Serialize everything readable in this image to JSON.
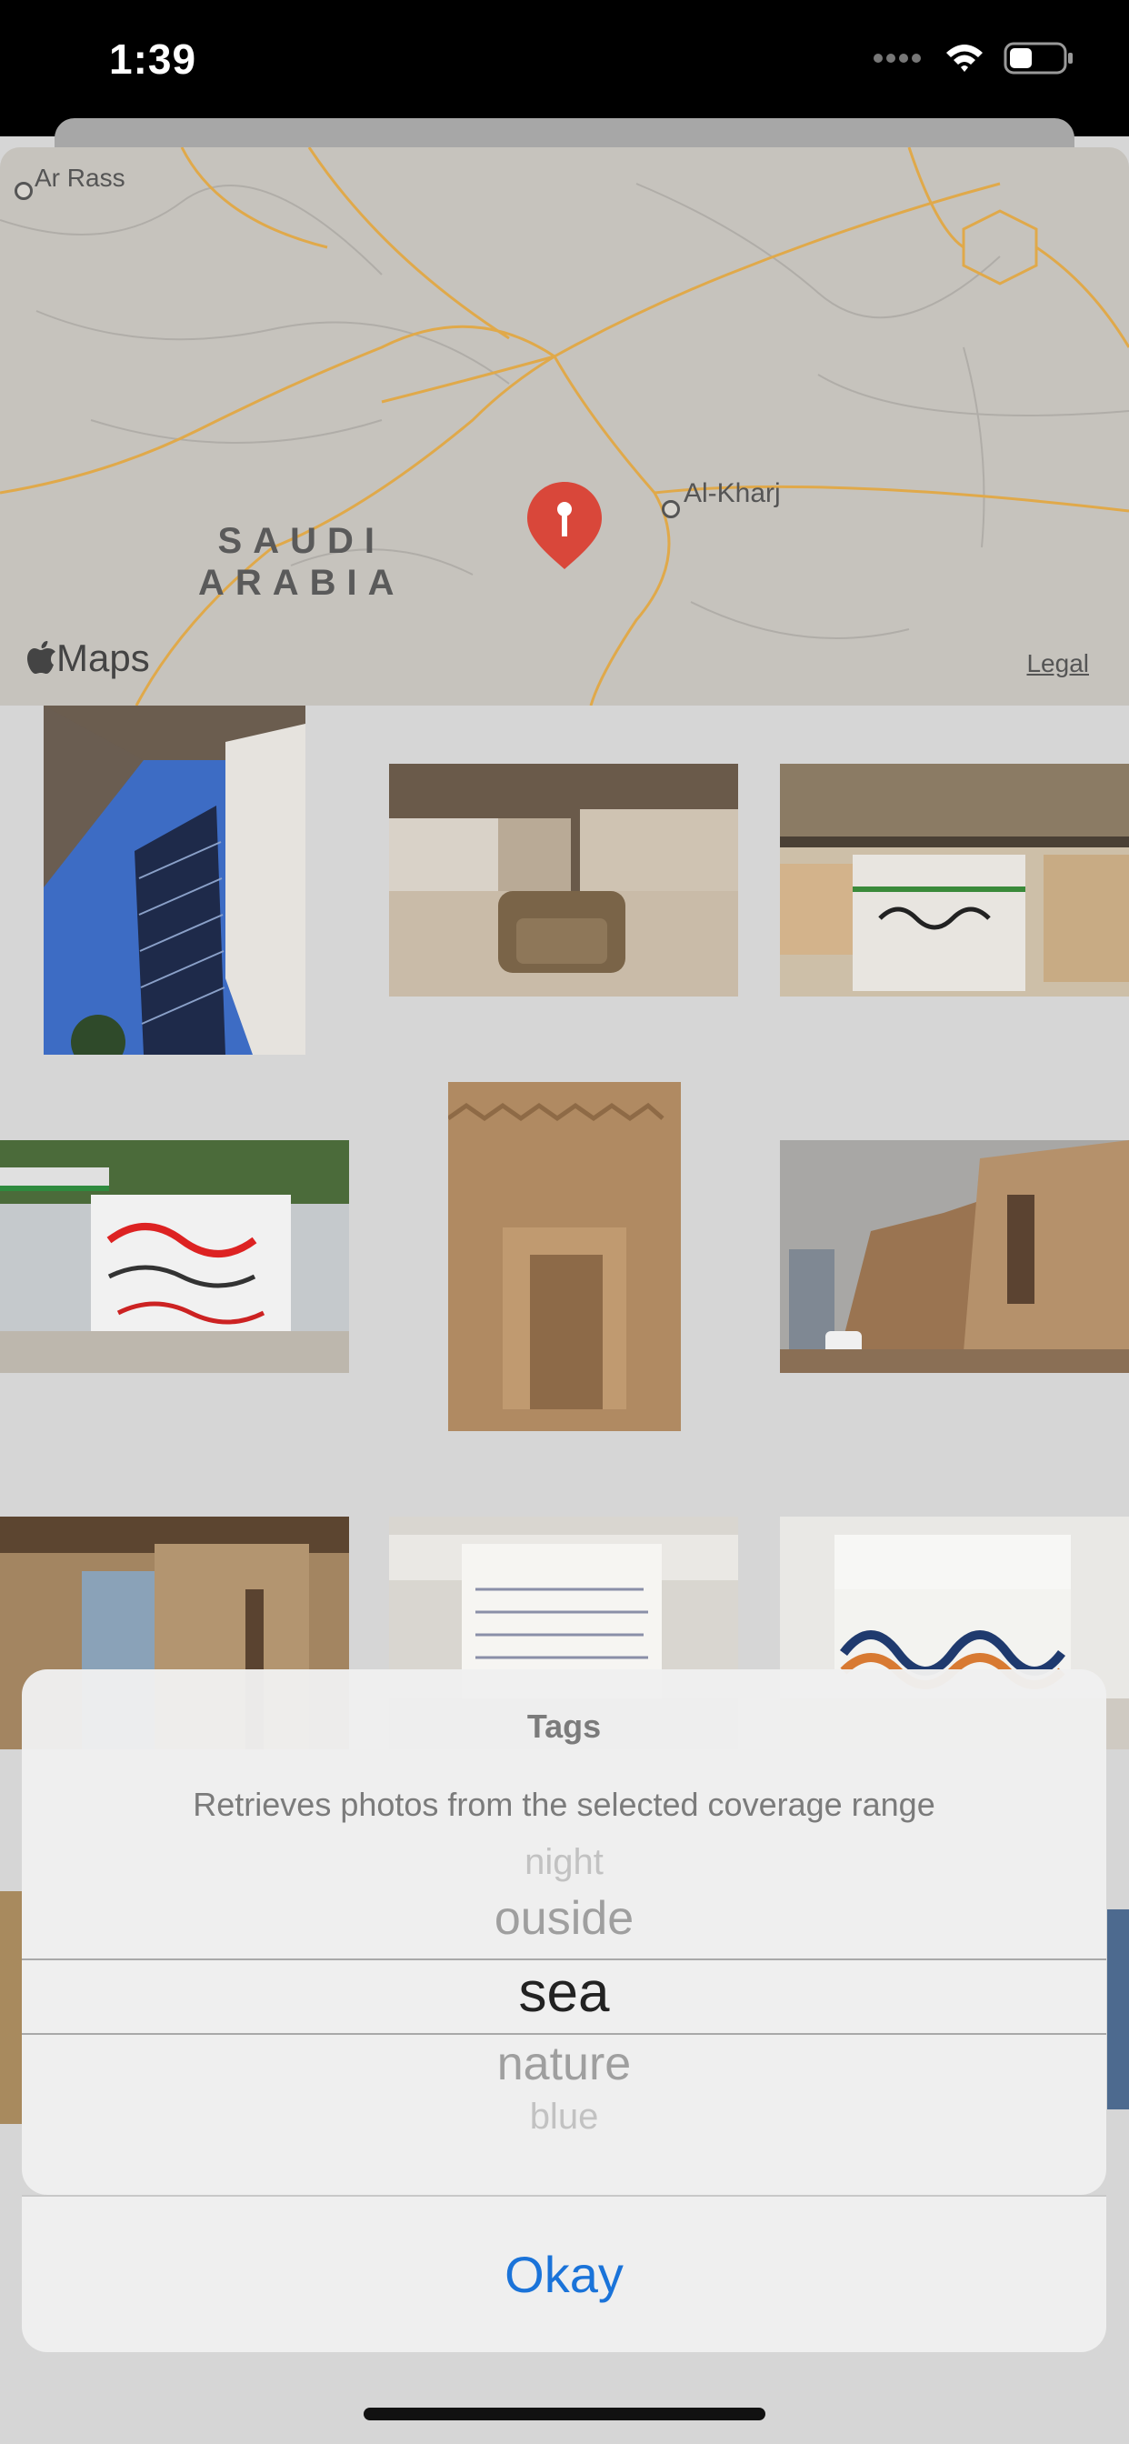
{
  "status_bar": {
    "time": "1:39"
  },
  "map": {
    "cities": [
      "Ar Rass",
      "Al-Kharj"
    ],
    "country": [
      "SAUDI",
      "ARABIA"
    ],
    "attribution": "Maps",
    "legal": "Legal"
  },
  "picker": {
    "title": "Tags",
    "message": "Retrieves photos from the selected coverage range",
    "options": [
      "night",
      "ouside",
      "sea",
      "nature",
      "blue"
    ],
    "selected": "sea",
    "confirm_label": "Okay"
  },
  "colors": {
    "accent": "#1a73d9",
    "pin": "#d9473a",
    "road": "#e0a94a"
  }
}
